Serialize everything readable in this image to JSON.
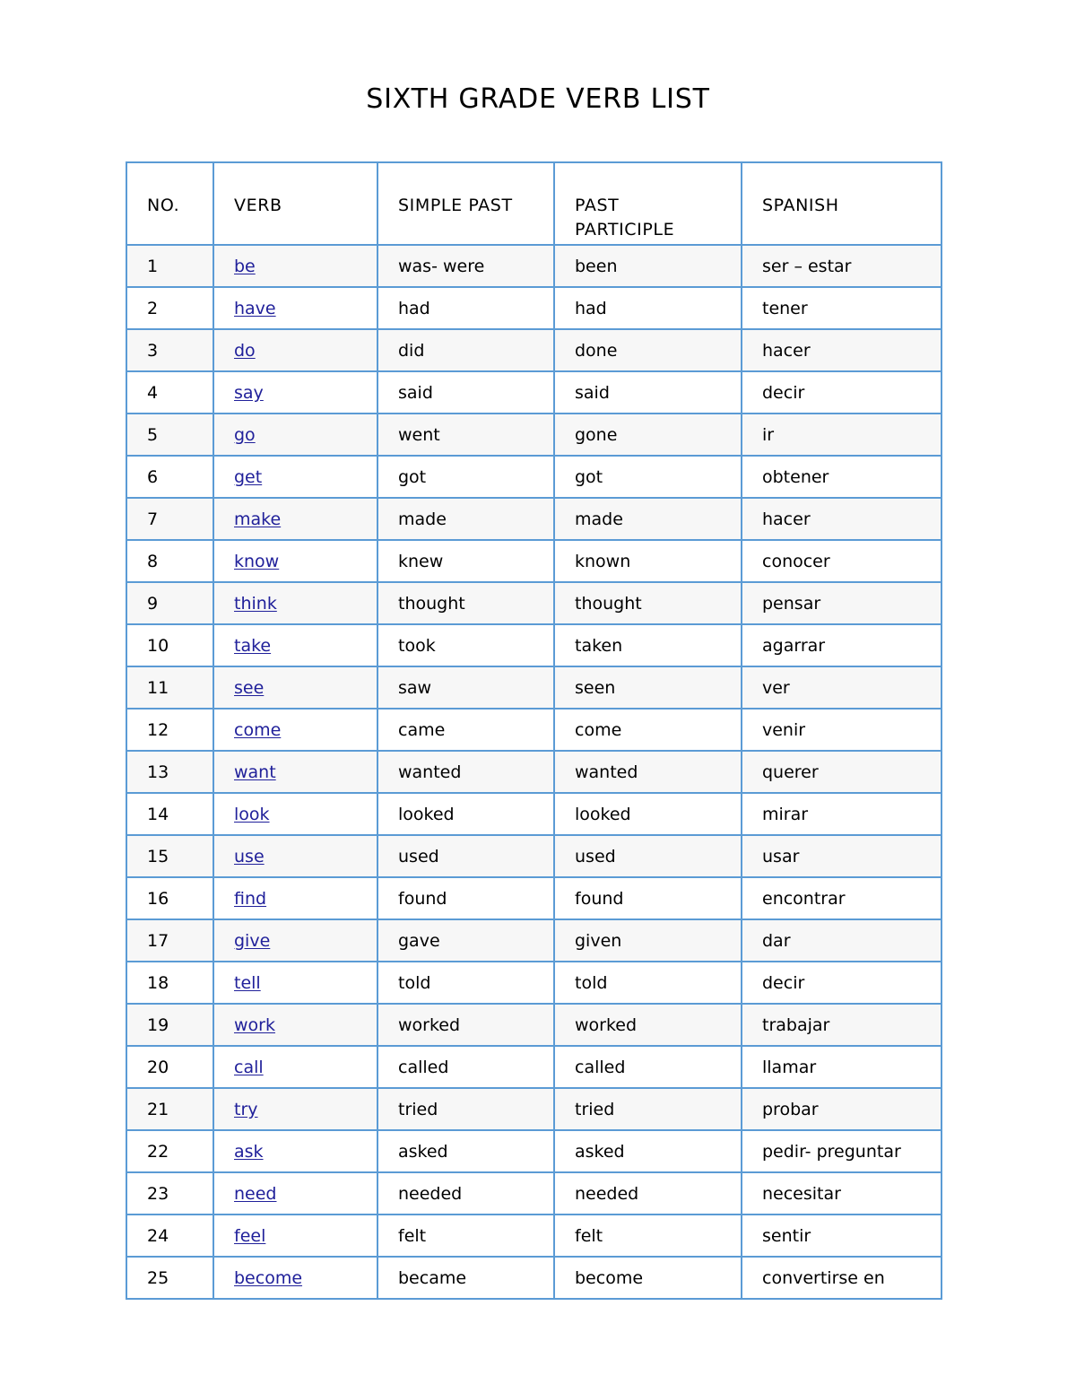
{
  "document": {
    "title": "SIXTH GRADE VERB LIST"
  },
  "table": {
    "columns": [
      {
        "key": "no",
        "label": "NO.",
        "label_line2": ""
      },
      {
        "key": "verb",
        "label": "VERB",
        "label_line2": ""
      },
      {
        "key": "simple_past",
        "label": "SIMPLE PAST",
        "label_line2": ""
      },
      {
        "key": "past_participle",
        "label": "PAST",
        "label_line2": "PARTICIPLE"
      },
      {
        "key": "spanish",
        "label": "SPANISH",
        "label_line2": ""
      }
    ],
    "border_color": "#5B9BD5",
    "shaded_row_color": "#F7F7F7",
    "link_color": "#20209A",
    "rows": [
      {
        "no": "1",
        "verb": "be",
        "simple_past": "was- were",
        "past_participle": "been",
        "spanish": "ser – estar",
        "shaded": true
      },
      {
        "no": "2",
        "verb": "have",
        "simple_past": "had",
        "past_participle": "had",
        "spanish": "tener",
        "shaded": false
      },
      {
        "no": "3",
        "verb": "do",
        "simple_past": "did",
        "past_participle": "done",
        "spanish": "hacer",
        "shaded": true
      },
      {
        "no": "4",
        "verb": "say",
        "simple_past": "said",
        "past_participle": "said",
        "spanish": "decir",
        "shaded": false
      },
      {
        "no": "5",
        "verb": "go",
        "simple_past": "went",
        "past_participle": "gone",
        "spanish": "ir",
        "shaded": true
      },
      {
        "no": "6",
        "verb": "get",
        "simple_past": "got",
        "past_participle": "got",
        "spanish": "obtener",
        "shaded": false
      },
      {
        "no": "7",
        "verb": "make",
        "simple_past": "made",
        "past_participle": "made",
        "spanish": "hacer",
        "shaded": true
      },
      {
        "no": "8",
        "verb": "know",
        "simple_past": "knew",
        "past_participle": "known",
        "spanish": "conocer",
        "shaded": false
      },
      {
        "no": "9",
        "verb": "think",
        "simple_past": "thought",
        "past_participle": "thought",
        "spanish": "pensar",
        "shaded": true
      },
      {
        "no": "10",
        "verb": "take",
        "simple_past": "took",
        "past_participle": "taken",
        "spanish": "agarrar",
        "shaded": false
      },
      {
        "no": "11",
        "verb": "see",
        "simple_past": "saw",
        "past_participle": "seen",
        "spanish": "ver",
        "shaded": true
      },
      {
        "no": "12",
        "verb": "come",
        "simple_past": "came",
        "past_participle": "come",
        "spanish": "venir",
        "shaded": false
      },
      {
        "no": "13",
        "verb": "want",
        "simple_past": "wanted",
        "past_participle": "wanted",
        "spanish": "querer",
        "shaded": true
      },
      {
        "no": "14",
        "verb": "look",
        "simple_past": "looked",
        "past_participle": "looked",
        "spanish": "mirar",
        "shaded": false
      },
      {
        "no": "15",
        "verb": "use",
        "simple_past": "used",
        "past_participle": "used",
        "spanish": "usar",
        "shaded": true
      },
      {
        "no": "16",
        "verb": "find",
        "simple_past": "found",
        "past_participle": "found",
        "spanish": "encontrar",
        "shaded": false
      },
      {
        "no": "17",
        "verb": "give",
        "simple_past": "gave",
        "past_participle": "given",
        "spanish": "dar",
        "shaded": true
      },
      {
        "no": "18",
        "verb": "tell",
        "simple_past": "told",
        "past_participle": "told",
        "spanish": "decir",
        "shaded": false
      },
      {
        "no": "19",
        "verb": "work",
        "simple_past": "worked",
        "past_participle": "worked",
        "spanish": "trabajar",
        "shaded": true
      },
      {
        "no": "20",
        "verb": "call",
        "simple_past": "called",
        "past_participle": "called",
        "spanish": "llamar",
        "shaded": false
      },
      {
        "no": "21",
        "verb": "try",
        "simple_past": "tried",
        "past_participle": "tried",
        "spanish": "probar",
        "shaded": true
      },
      {
        "no": "22",
        "verb": "ask",
        "simple_past": "asked",
        "past_participle": "asked",
        "spanish": "pedir- preguntar",
        "shaded": false
      },
      {
        "no": "23",
        "verb": "need",
        "simple_past": "needed",
        "past_participle": "needed",
        "spanish": "necesitar",
        "shaded": false
      },
      {
        "no": "24",
        "verb": "feel",
        "simple_past": "felt",
        "past_participle": "felt",
        "spanish": "sentir",
        "shaded": false
      },
      {
        "no": "25",
        "verb": "become",
        "simple_past": "became",
        "past_participle": "become",
        "spanish": "convertirse en",
        "shaded": false
      }
    ]
  }
}
